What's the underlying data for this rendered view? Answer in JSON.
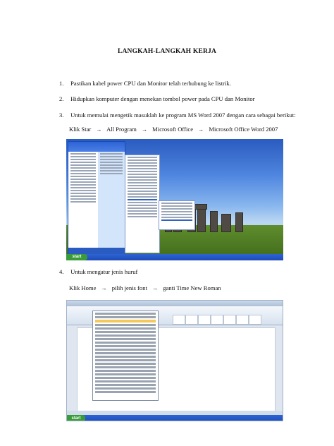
{
  "title": "LANGKAH-LANGKAH KERJA",
  "steps": [
    {
      "num": "1.",
      "text": "Pastikan kabel power CPU dan Monitor telah terhubung ke listrik."
    },
    {
      "num": "2.",
      "text": "Hidupkan komputer dengan menekan tombol power pada CPU dan Monitor"
    },
    {
      "num": "3.",
      "text": "Untuk memulai mengetik masuklah ke program MS Word 2007 dengan cara sebagai berikut:"
    },
    {
      "num": "4.",
      "text": "Untuk mengatur jenis huruf"
    }
  ],
  "path1": [
    "Klik Star",
    "All Program",
    "Microsoft Office",
    "Microsoft Office Word 2007"
  ],
  "path2": [
    "Klik Home",
    "pilih jenis font",
    "ganti Time New Roman"
  ],
  "arrow_glyph": "→",
  "shot1": {
    "start_label": "start"
  },
  "shot2": {
    "start_label": "start"
  }
}
